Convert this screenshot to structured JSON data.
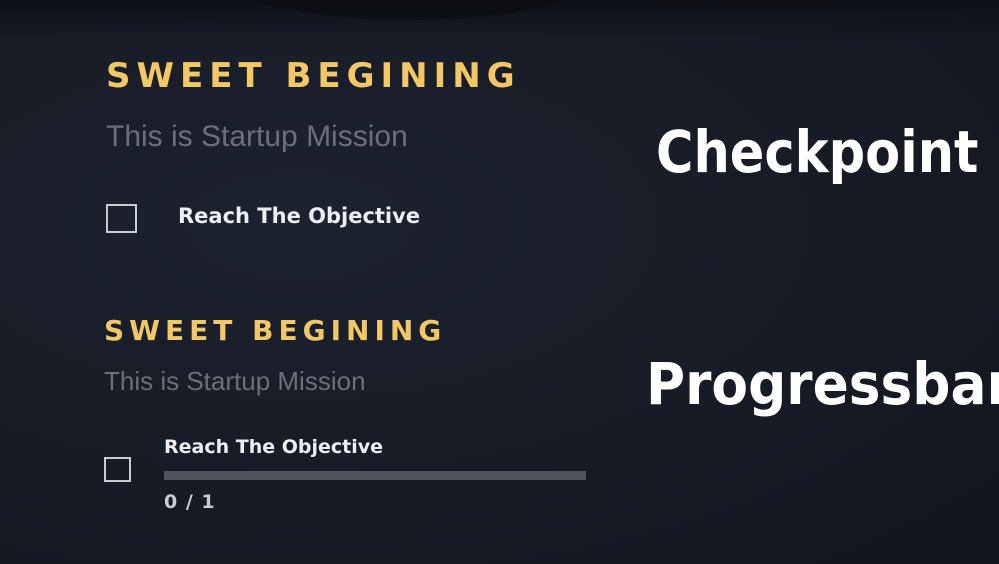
{
  "checkpoint_panel": {
    "title": "SWEET BEGINING",
    "subtitle": "This is Startup Mission",
    "objective": {
      "label": "Reach The Objective",
      "checked": false
    },
    "caption": "Checkpoint"
  },
  "progressbar_panel": {
    "title": "SWEET BEGINING",
    "subtitle": "This is Startup Mission",
    "objective": {
      "label": "Reach The Objective",
      "checked": false,
      "progress_count": "0 / 1",
      "progress_fraction": 0
    },
    "caption": "Progressbar"
  },
  "colors": {
    "title": "#f2c766",
    "subtitle": "#6a6f79",
    "objective_text": "#eceef2",
    "progress_track": "#4e535c",
    "background": "#171b25"
  }
}
